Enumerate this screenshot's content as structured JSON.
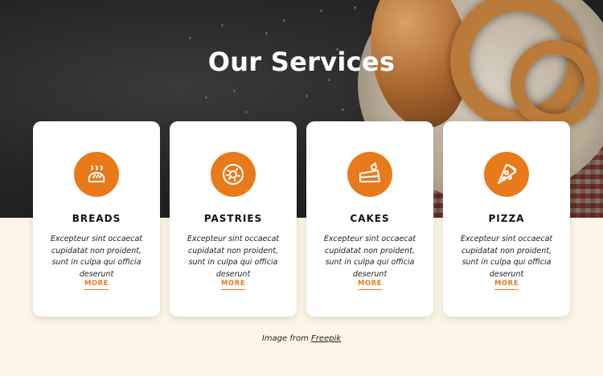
{
  "hero": {
    "title": "Our Services"
  },
  "services": [
    {
      "icon": "bread-icon",
      "title": "BREADS",
      "text": "Excepteur sint occaecat cupidatat non proident, sunt in culpa qui officia deserunt",
      "more": "MORE"
    },
    {
      "icon": "donut-icon",
      "title": "PASTRIES",
      "text": "Excepteur sint occaecat cupidatat non proident, sunt in culpa qui officia deserunt",
      "more": "MORE"
    },
    {
      "icon": "cake-icon",
      "title": "CAKES",
      "text": "Excepteur sint occaecat cupidatat non proident, sunt in culpa qui officia deserunt",
      "more": "MORE"
    },
    {
      "icon": "pizza-icon",
      "title": "PIZZA",
      "text": "Excepteur sint occaecat cupidatat non proident, sunt in culpa qui officia deserunt",
      "more": "MORE"
    }
  ],
  "credit": {
    "prefix": "Image from",
    "link": "Freepik"
  },
  "colors": {
    "accent": "#e87a1c",
    "background": "#fdf6e6",
    "card": "#ffffff"
  }
}
